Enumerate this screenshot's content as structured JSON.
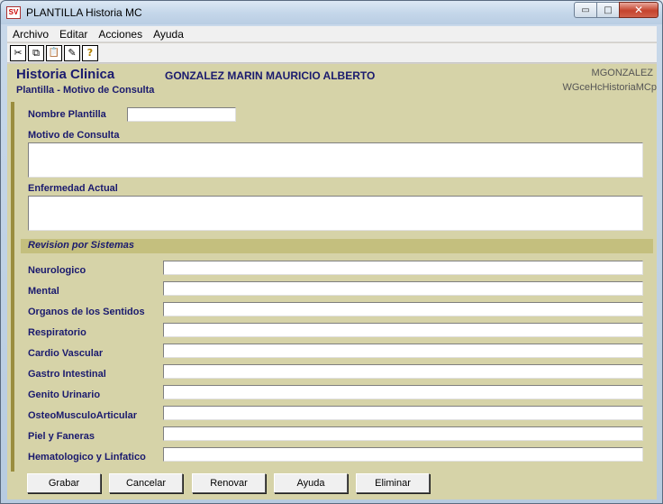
{
  "window": {
    "title": "PLANTILLA Historia MC",
    "icon": "app-logo-icon",
    "minimize": "▭",
    "maximize": "□",
    "close": "✕"
  },
  "menu": [
    "Archivo",
    "Editar",
    "Acciones",
    "Ayuda"
  ],
  "toolbar": [
    {
      "name": "cut-icon",
      "glyph": "✂"
    },
    {
      "name": "copy-icon",
      "glyph": "⧉"
    },
    {
      "name": "paste-icon",
      "glyph": "📋"
    },
    {
      "name": "brush-icon",
      "glyph": "✎"
    },
    {
      "name": "help-icon",
      "glyph": "?"
    }
  ],
  "header": {
    "title": "Historia Clinica",
    "subtitle": "Plantilla - Motivo de Consulta",
    "patient": "GONZALEZ MARIN MAURICIO ALBERTO",
    "user": "MGONZALEZ",
    "window_id": "WGceHcHistoriaMCp"
  },
  "form": {
    "nombre_plantilla_label": "Nombre Plantilla",
    "nombre_plantilla_value": "",
    "motivo_label": "Motivo de Consulta",
    "motivo_value": "",
    "enfermedad_label": "Enfermedad Actual",
    "enfermedad_value": "",
    "revision_title": "Revision por Sistemas",
    "sistemas": [
      {
        "label": "Neurologico",
        "value": ""
      },
      {
        "label": "Mental",
        "value": ""
      },
      {
        "label": "Organos de los Sentidos",
        "value": ""
      },
      {
        "label": "Respiratorio",
        "value": ""
      },
      {
        "label": "Cardio Vascular",
        "value": ""
      },
      {
        "label": "Gastro Intestinal",
        "value": ""
      },
      {
        "label": "Genito Urinario",
        "value": ""
      },
      {
        "label": "OsteoMusculoArticular",
        "value": ""
      },
      {
        "label": "Piel y Faneras",
        "value": ""
      },
      {
        "label": "Hematologico y Linfatico",
        "value": ""
      }
    ]
  },
  "buttons": {
    "grabar": "Grabar",
    "cancelar": "Cancelar",
    "renovar": "Renovar",
    "ayuda": "Ayuda",
    "eliminar": "Eliminar"
  },
  "colors": {
    "form_bg": "#d6d3a8",
    "label_text": "#1a1a6e",
    "section_bar": "#c4bf7e",
    "accent_bar": "#9a8d3e"
  }
}
